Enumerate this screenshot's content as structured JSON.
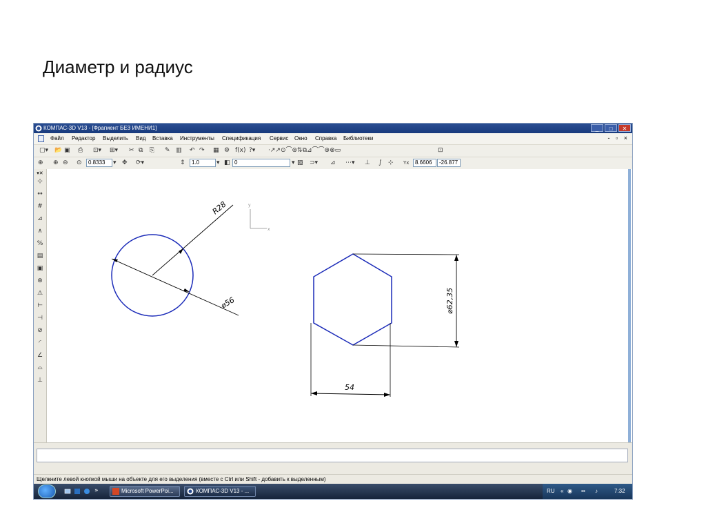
{
  "slide": {
    "title": "Диаметр и радиус"
  },
  "window": {
    "title": "КОМПАС-3D V13 - [Фрагмент БЕЗ ИМЕНИ1]",
    "controls": {
      "minimize": "_",
      "maximize": "□",
      "close": "✕"
    }
  },
  "menu": {
    "items": [
      "Файл",
      "Редактор",
      "Выделить",
      "Вид",
      "Вставка",
      "Инструменты",
      "Спецификация",
      "Сервис",
      "Окно",
      "Справка",
      "Библиотеки"
    ],
    "mdi_controls": "- ▫ ×"
  },
  "toolbar2": {
    "scale_value": "0.8333",
    "step_value": "1.0",
    "layer_value": "0",
    "coord_x": "8.6606",
    "coord_y": "-26.877"
  },
  "drawing": {
    "radius_label": "R28",
    "diameter_label": "⌀56",
    "hex_height_label": "⌀62,35",
    "hex_width_label": "54",
    "axis_x": "x",
    "axis_y": "y"
  },
  "status": {
    "text": "Щелкните левой кнопкой мыши на объекте для его выделения (вместе с Ctrl или Shift - добавить к выделенным)"
  },
  "taskbar": {
    "buttons": [
      "Microsoft PowerPoi...",
      "КОМПАС-3D V13 - ..."
    ],
    "lang": "RU",
    "time": "7:32"
  },
  "colors": {
    "titlebar": "#1f438a",
    "geometry": "#1a2ab8",
    "dimension": "#000000",
    "scrollbar": "#8fb0d8"
  }
}
